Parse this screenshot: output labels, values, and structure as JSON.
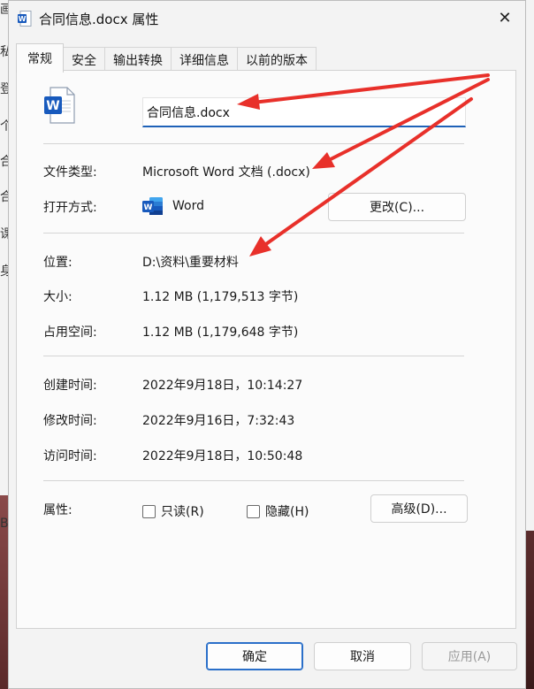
{
  "dialog": {
    "title": "合同信息.docx 属性"
  },
  "tabs": [
    {
      "label": "常规",
      "active": true
    },
    {
      "label": "安全"
    },
    {
      "label": "输出转换"
    },
    {
      "label": "详细信息"
    },
    {
      "label": "以前的版本"
    }
  ],
  "general": {
    "file_name": "合同信息.docx",
    "file_type_label": "文件类型:",
    "file_type_value": "Microsoft Word 文档 (.docx)",
    "open_with_label": "打开方式:",
    "open_with_app": "Word",
    "change_button": "更改(C)...",
    "location_label": "位置:",
    "location_value": "D:\\资料\\重要材料",
    "size_label": "大小:",
    "size_value": "1.12 MB (1,179,513 字节)",
    "disk_size_label": "占用空间:",
    "disk_size_value": "1.12 MB (1,179,648 字节)",
    "created_label": "创建时间:",
    "created_value": "2022年9月18日，10:14:27",
    "modified_label": "修改时间:",
    "modified_value": "2022年9月16日，7:32:43",
    "accessed_label": "访问时间:",
    "accessed_value": "2022年9月18日，10:50:48",
    "attributes_label": "属性:",
    "readonly_label": "只读(R)",
    "hidden_label": "隐藏(H)",
    "advanced_button": "高级(D)..."
  },
  "footer": {
    "ok": "确定",
    "cancel": "取消",
    "apply": "应用(A)"
  },
  "background_chars": [
    "画",
    "私",
    "登",
    "个",
    "合",
    "合",
    "课",
    "身",
    "B"
  ],
  "colors": {
    "accent": "#1f62b8",
    "annotation_arrow": "#e8302a",
    "word_blue": "#185abd"
  }
}
